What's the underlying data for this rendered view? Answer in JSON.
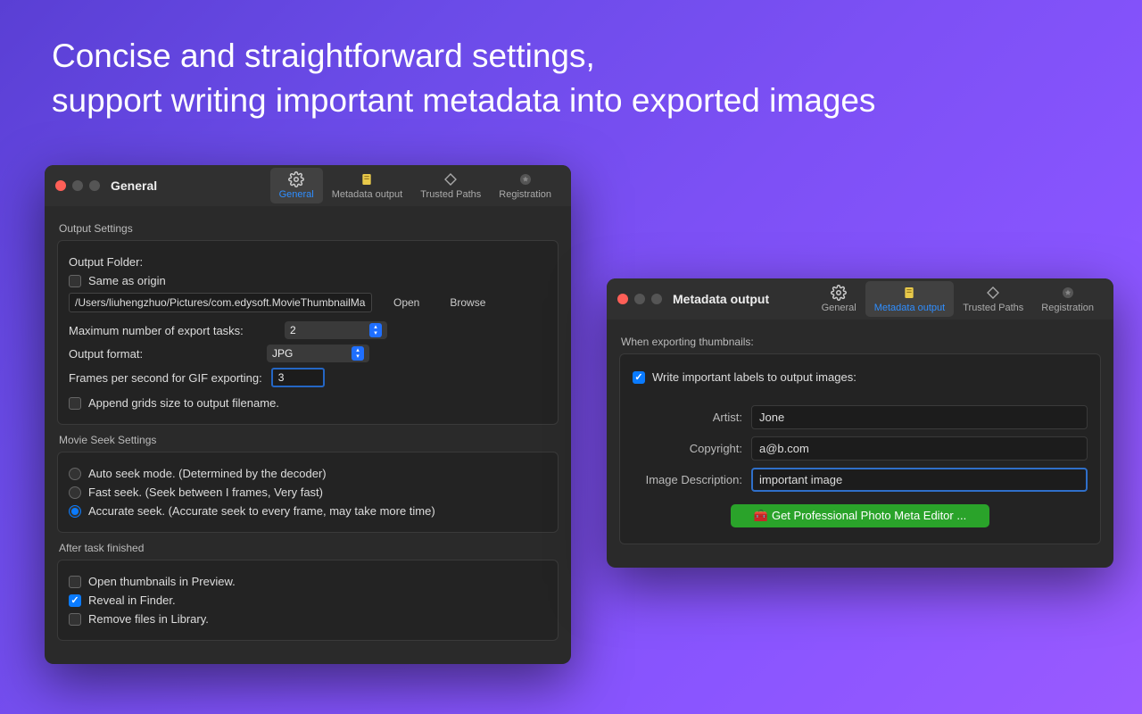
{
  "headline": {
    "line1": "Concise and straightforward settings,",
    "line2": "support writing important metadata into exported images"
  },
  "window1": {
    "title": "General",
    "tabs": [
      {
        "label": "General",
        "icon": "gear"
      },
      {
        "label": "Metadata output",
        "icon": "note"
      },
      {
        "label": "Trusted Paths",
        "icon": "diamond"
      },
      {
        "label": "Registration",
        "icon": "star"
      }
    ],
    "output_settings": {
      "group": "Output Settings",
      "folder_label": "Output Folder:",
      "same_as_origin": "Same as origin",
      "path": "/Users/liuhengzhuo/Pictures/com.edysoft.MovieThumbnailMaker",
      "open": "Open",
      "browse": "Browse",
      "max_tasks_label": "Maximum number of export tasks:",
      "max_tasks_value": "2",
      "output_format_label": "Output format:",
      "output_format_value": "JPG",
      "fps_label": "Frames per second for GIF exporting:",
      "fps_value": "3",
      "append_grids": "Append grids size to output filename."
    },
    "seek": {
      "group": "Movie Seek Settings",
      "auto": "Auto seek mode. (Determined by the decoder)",
      "fast": "Fast seek. (Seek between I frames, Very fast)",
      "accurate": "Accurate seek. (Accurate seek to every frame, may take more time)"
    },
    "after": {
      "group": "After task finished",
      "open_preview": "Open thumbnails in Preview.",
      "reveal_finder": "Reveal in Finder.",
      "remove_library": "Remove files in Library."
    }
  },
  "window2": {
    "title": "Metadata output",
    "tabs": [
      {
        "label": "General",
        "icon": "gear"
      },
      {
        "label": "Metadata output",
        "icon": "note"
      },
      {
        "label": "Trusted Paths",
        "icon": "diamond"
      },
      {
        "label": "Registration",
        "icon": "star"
      }
    ],
    "section_label": "When exporting thumbnails:",
    "write_labels": "Write important labels to output images:",
    "artist_label": "Artist:",
    "artist_value": "Jone",
    "copyright_label": "Copyright:",
    "copyright_value": "a@b.com",
    "desc_label": "Image Description:",
    "desc_value": "important image",
    "get_pro": "Get Professional Photo Meta Editor ..."
  }
}
